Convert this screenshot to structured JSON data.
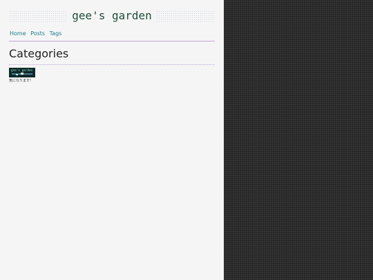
{
  "site": {
    "title": "gee's garden"
  },
  "nav": {
    "items": [
      {
        "label": "Home"
      },
      {
        "label": "Posts"
      },
      {
        "label": "Tags"
      }
    ]
  },
  "page": {
    "heading": "Categories"
  },
  "categories": [
    {
      "thumb_text": "gee's garden",
      "label": "気になります!"
    }
  ],
  "colors": {
    "main_bg": "#f5f5f5",
    "side_bg": "#262626",
    "title": "#1f4f3a",
    "link": "#1b7f8c",
    "rule": "#c7a2d6"
  }
}
